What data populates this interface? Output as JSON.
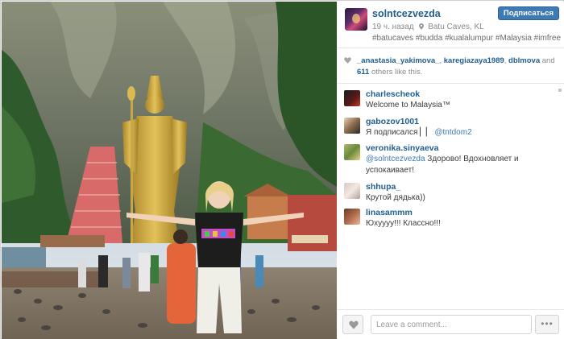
{
  "post": {
    "username": "solntcezvezda",
    "time_ago": "19 ч. назад",
    "location": "Batu Caves, KL",
    "hashtags": "#batucaves #budda #kualalumpur #Malaysia #imfree",
    "follow_label": "Подписаться"
  },
  "likes": {
    "user1": "_anastasia_yakimova_",
    "user2": "karegiazaya1989",
    "user3": "dblmova",
    "and": " and ",
    "count": "611",
    "suffix": " others like this."
  },
  "comments": [
    {
      "user": "charlescheok",
      "text": "Welcome to Malaysia™"
    },
    {
      "user": "gabozov1001",
      "text": "Я подписался ▏▏ ",
      "mention": "@tntdom2"
    },
    {
      "user": "veronika.sinyaeva",
      "mention": "@solntcezvezda",
      "text": " Здорово! Вдохновляет и успокаивает!"
    },
    {
      "user": "shhupa_",
      "text": "Крутой дядька))"
    },
    {
      "user": "linasammm",
      "text": "Юхуууу!!! Классно!!!"
    }
  ],
  "footer": {
    "comment_placeholder": "Leave a comment...",
    "more_label": "•••"
  },
  "colors": {
    "link": "#1f5e8f",
    "follow_button": "#3f7ab5"
  }
}
